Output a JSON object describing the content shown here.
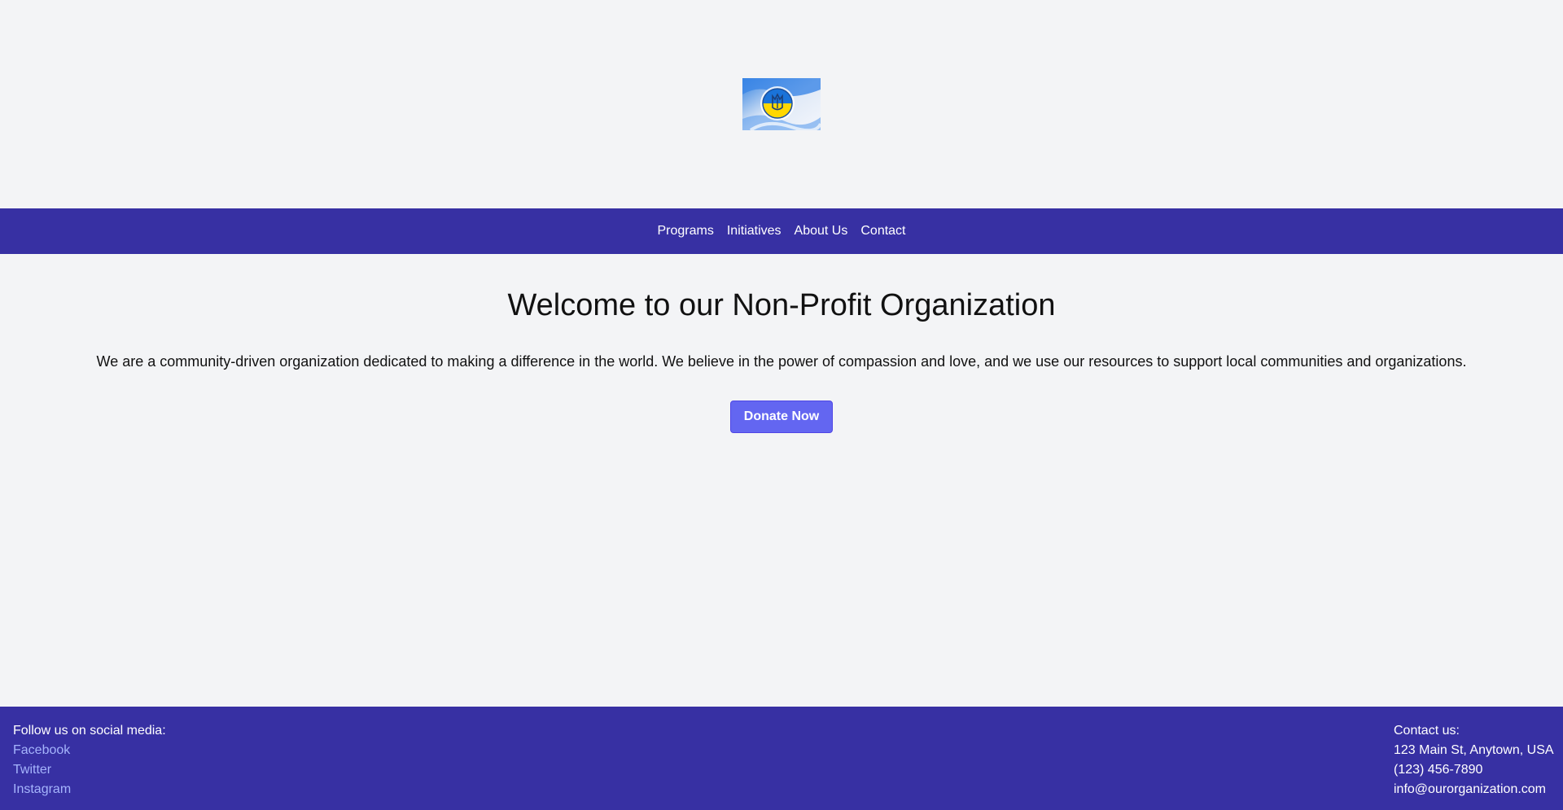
{
  "header": {
    "logo_name": "ukraine-flag-logo",
    "logo_colors": {
      "blue": "#0057b7",
      "yellow": "#ffd700"
    }
  },
  "nav": {
    "items": [
      {
        "label": "Programs"
      },
      {
        "label": "Initiatives"
      },
      {
        "label": "About Us"
      },
      {
        "label": "Contact"
      }
    ]
  },
  "hero": {
    "title": "Welcome to our Non-Profit Organization",
    "description": "We are a community-driven organization dedicated to making a difference in the world. We believe in the power of compassion and love, and we use our resources to support local communities and organizations.",
    "donate_label": "Donate Now"
  },
  "footer": {
    "social_heading": "Follow us on social media:",
    "social_links": [
      {
        "label": "Facebook"
      },
      {
        "label": "Twitter"
      },
      {
        "label": "Instagram"
      }
    ],
    "contact_heading": "Contact us:",
    "address": "123 Main St, Anytown, USA",
    "phone": "(123) 456-7890",
    "email": "info@ourorganization.com"
  },
  "colors": {
    "background": "#f3f4f6",
    "nav_bg": "#3730a3",
    "button_bg": "#6366f1",
    "link_color": "#a5b4fc"
  }
}
